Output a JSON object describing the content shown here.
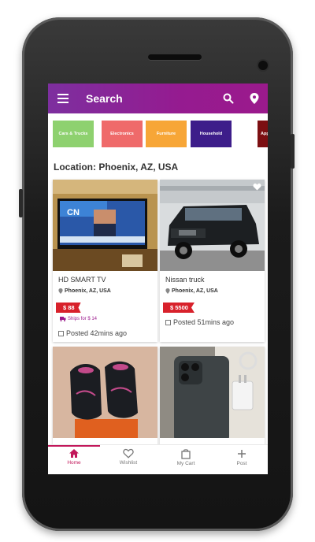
{
  "header": {
    "title": "Search",
    "menu_icon": "menu-icon",
    "search_icon": "search-icon",
    "location_icon": "location-pin-icon"
  },
  "categories": [
    {
      "label": "Cars & Trucks",
      "color": "#8ed16f"
    },
    {
      "label": "Electronics",
      "color": "#ef6a6a"
    },
    {
      "label": "Furniture",
      "color": "#f7a637"
    },
    {
      "label": "Household",
      "color": "#3d1d8a"
    },
    {
      "label": "Applianc",
      "color": "#7c0f12"
    }
  ],
  "location_label": "Location: Phoenix, AZ, USA",
  "listings": [
    {
      "title": "HD SMART TV",
      "location": "Phoenix, AZ, USA",
      "price": "$ 88",
      "shipping": "Ships for $ 14",
      "posted": "Posted 42mins ago"
    },
    {
      "title": "Nissan truck",
      "location": "Phoenix, AZ, USA",
      "price": "$ 5500",
      "shipping": "",
      "posted": "Posted 51mins ago"
    },
    {
      "title": "",
      "location": "",
      "price": "",
      "shipping": "",
      "posted": ""
    },
    {
      "title": "",
      "location": "",
      "price": "",
      "shipping": "",
      "posted": ""
    }
  ],
  "nav": [
    {
      "label": "Home",
      "icon": "home-icon"
    },
    {
      "label": "Wishlist",
      "icon": "heart-icon"
    },
    {
      "label": "My Cart",
      "icon": "shopping-bag-icon"
    },
    {
      "label": "Post",
      "icon": "plus-icon"
    }
  ],
  "colors": {
    "appbar": "#951b90",
    "accent": "#c2185b",
    "price": "#d8212b"
  }
}
